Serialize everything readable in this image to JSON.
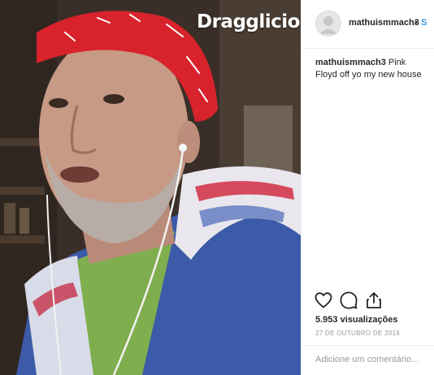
{
  "media": {
    "watermark": "Dragglicious",
    "colors": {
      "bandana": "#d8232c",
      "hoodie_blue": "#3b5aa7",
      "skin": "#c79a86",
      "background": "#3a2f28"
    }
  },
  "header": {
    "username": "mathuismmach3",
    "separator": "•",
    "follow_label": "S"
  },
  "caption": {
    "username": "mathuismmach3",
    "text": "Pink Floyd off yo my new house"
  },
  "actions": {
    "like_icon": "heart-icon",
    "comment_icon": "comment-icon",
    "share_icon": "share-icon"
  },
  "stats": {
    "views": "5.953 visualizações",
    "date": "27 DE OUTUBRO DE 2016"
  },
  "comment": {
    "placeholder": "Adicione um comentário..."
  }
}
